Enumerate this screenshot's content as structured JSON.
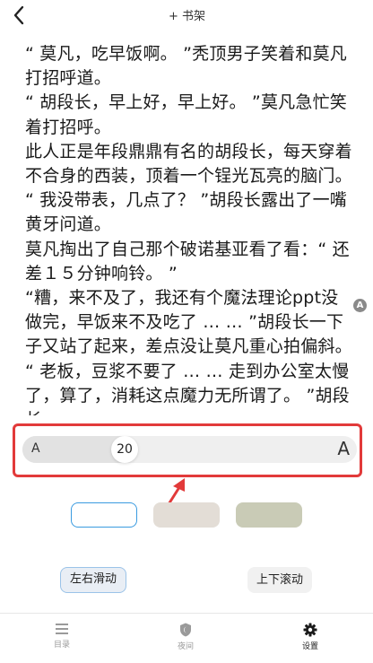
{
  "header": {
    "add_to_shelf": "+ 书架"
  },
  "reader": {
    "paragraphs": [
      "“ 莫凡，吃早饭啊。 ”秃顶男子笑着和莫凡打招呼道。",
      "“ 胡段长，早上好，早上好。 ”莫凡急忙笑着打招呼。",
      "此人正是年段鼎鼎有名的胡段长，每天穿着不合身的西装，顶着一个锃光瓦亮的脑门。",
      "“ 我没带表，几点了？ ”胡段长露出了一嘴黄牙问道。",
      "莫凡掏出了自己那个破诺基亚看了看：“ 还差１５分钟响铃。 ”",
      "“糟，来不及了，我还有个魔法理论ppt没做完，早饭来不及吃了 … … ”胡段长一下子又站了起来，差点没让莫凡重心拍偏斜。",
      "“ 老板，豆浆不要了 … … 走到办公室太慢了，算了，消耗这点魔力无所谓了。 ”胡段长"
    ],
    "side_badge": "A"
  },
  "settings": {
    "font_size": {
      "small_label": "A",
      "large_label": "A",
      "value": "20",
      "level_fraction": 0.29
    },
    "themes": [
      {
        "name": "white",
        "color": "#ffffff",
        "selected": true
      },
      {
        "name": "beige",
        "color": "#e3ddd6",
        "selected": false
      },
      {
        "name": "green",
        "color": "#c9cbb6",
        "selected": false
      }
    ],
    "page_mode": {
      "horizontal": "左右滑动",
      "vertical": "上下滚动",
      "selected": "horizontal"
    },
    "highlight_color": "#e23a3a",
    "accent_color": "#3a9be0"
  },
  "bottom_nav": {
    "toc": {
      "label": "目录",
      "icon": "list-icon"
    },
    "night": {
      "label": "夜间",
      "icon": "moon-icon"
    },
    "settings": {
      "label": "设置",
      "icon": "gear-icon"
    }
  }
}
